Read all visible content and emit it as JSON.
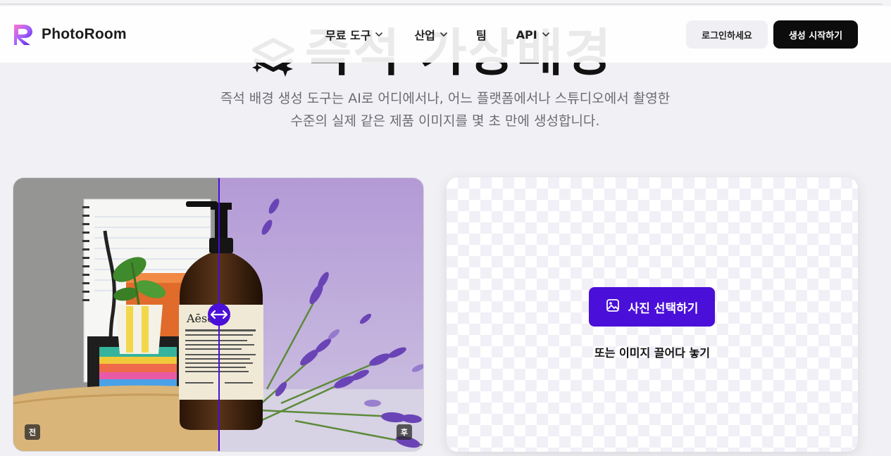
{
  "brand": {
    "name": "PhotoRoom"
  },
  "nav": {
    "items": [
      {
        "label": "무료 도구",
        "has_dropdown": true
      },
      {
        "label": "산업",
        "has_dropdown": true
      },
      {
        "label": "팀",
        "has_dropdown": false
      },
      {
        "label": "API",
        "has_dropdown": true
      }
    ],
    "login_label": "로그인하세요",
    "start_label": "생성 시작하기"
  },
  "hero": {
    "title": "즉석 가상배경",
    "subtitle_line1": "즉석 배경 생성 도구는 AI로 어디에서나, 어느 플랫폼에서나 스튜디오에서 촬영한",
    "subtitle_line2": "수준의 실제 같은 제품 이미지를 몇 초 만에 생성합니다."
  },
  "compare": {
    "before_label": "전",
    "after_label": "후",
    "product_brand": "Aēsop."
  },
  "upload": {
    "button_label": "사진 선택하기",
    "drop_text": "또는 이미지 끌어다 놓기"
  },
  "colors": {
    "accent": "#4a0fd8",
    "background": "#f1f1f5",
    "lavender_bg": "#b7a3d8"
  }
}
